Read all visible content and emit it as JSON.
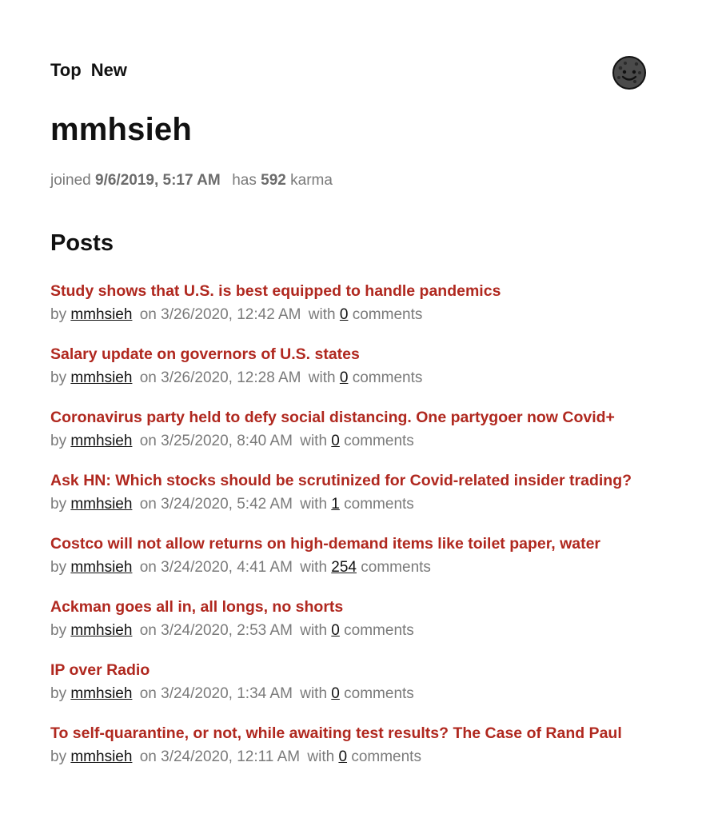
{
  "nav": {
    "top_label": "Top",
    "new_label": "New"
  },
  "avatar_icon": "cookie-face-icon",
  "user": {
    "name": "mmhsieh",
    "joined_label": "joined",
    "joined_value": "9/6/2019, 5:17 AM",
    "has_label": "has",
    "karma_value": "592",
    "karma_label": "karma"
  },
  "section_title": "Posts",
  "meta_words": {
    "by": "by",
    "on": "on",
    "with": "with",
    "comments": "comments"
  },
  "posts": [
    {
      "title": "Study shows that U.S. is best equipped to handle pandemics",
      "author": "mmhsieh",
      "date": "3/26/2020, 12:42 AM",
      "comments": "0"
    },
    {
      "title": "Salary update on governors of U.S. states",
      "author": "mmhsieh",
      "date": "3/26/2020, 12:28 AM",
      "comments": "0"
    },
    {
      "title": "Coronavirus party held to defy social distancing. One partygoer now Covid+",
      "author": "mmhsieh",
      "date": "3/25/2020, 8:40 AM",
      "comments": "0"
    },
    {
      "title": "Ask HN: Which stocks should be scrutinized for Covid-related insider trading?",
      "author": "mmhsieh",
      "date": "3/24/2020, 5:42 AM",
      "comments": "1"
    },
    {
      "title": "Costco will not allow returns on high-demand items like toilet paper, water",
      "author": "mmhsieh",
      "date": "3/24/2020, 4:41 AM",
      "comments": "254"
    },
    {
      "title": "Ackman goes all in, all longs, no shorts",
      "author": "mmhsieh",
      "date": "3/24/2020, 2:53 AM",
      "comments": "0"
    },
    {
      "title": "IP over Radio",
      "author": "mmhsieh",
      "date": "3/24/2020, 1:34 AM",
      "comments": "0"
    },
    {
      "title": "To self-quarantine, or not, while awaiting test results? The Case of Rand Paul",
      "author": "mmhsieh",
      "date": "3/24/2020, 12:11 AM",
      "comments": "0"
    }
  ],
  "colors": {
    "link_red": "#b0281f",
    "meta_gray": "#7a7a7a",
    "text": "#111111"
  }
}
